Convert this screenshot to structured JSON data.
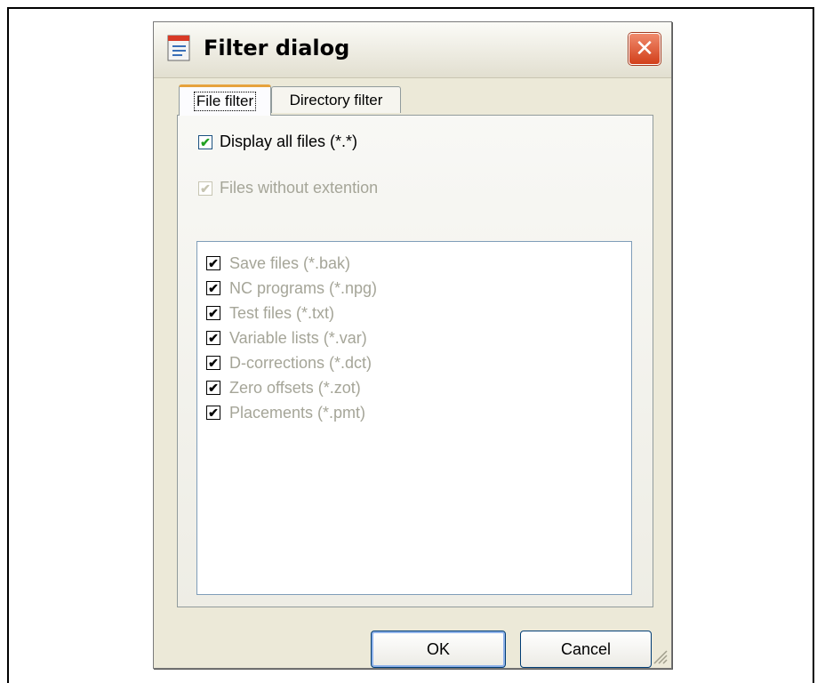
{
  "dialog": {
    "title": "Filter dialog",
    "close_icon": "close-icon"
  },
  "tabs": [
    {
      "label": "File filter",
      "active": true
    },
    {
      "label": "Directory filter",
      "active": false
    }
  ],
  "options": {
    "display_all": {
      "label": "Display all files (*.*)",
      "checked": true,
      "enabled": true
    },
    "without_ext": {
      "label": "Files without extention",
      "checked": true,
      "enabled": false
    }
  },
  "file_types": [
    {
      "label": "Save files (*.bak)",
      "checked": true
    },
    {
      "label": "NC programs (*.npg)",
      "checked": true
    },
    {
      "label": "Test files (*.txt)",
      "checked": true
    },
    {
      "label": "Variable lists (*.var)",
      "checked": true
    },
    {
      "label": "D-corrections (*.dct)",
      "checked": true
    },
    {
      "label": "Zero offsets (*.zot)",
      "checked": true
    },
    {
      "label": "Placements (*.pmt)",
      "checked": true
    }
  ],
  "buttons": {
    "ok": "OK",
    "cancel": "Cancel"
  },
  "colors": {
    "dialog_bg": "#ece9d8",
    "accent_tab": "#e6a23c",
    "close_red": "#d2401b"
  }
}
